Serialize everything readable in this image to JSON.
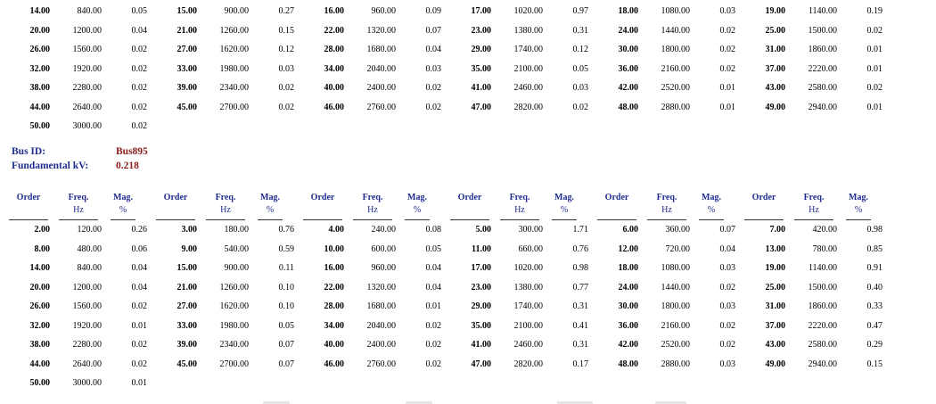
{
  "colors": {
    "label": "#1f2d8f",
    "value": "#8b1a1a"
  },
  "bus_info": {
    "bus_id_label": "Bus ID:",
    "bus_id_value": "Bus895",
    "fund_kv_label": "Fundamental kV:",
    "fund_kv_value": "0.218"
  },
  "headers": [
    {
      "top": "Order",
      "bottom": ""
    },
    {
      "top": "Freq.",
      "bottom": "Hz"
    },
    {
      "top": "Mag.",
      "bottom": "%"
    }
  ],
  "table1": {
    "rows": [
      [
        [
          "14.00",
          "840.00",
          "0.05"
        ],
        [
          "15.00",
          "900.00",
          "0.27"
        ],
        [
          "16.00",
          "960.00",
          "0.09"
        ],
        [
          "17.00",
          "1020.00",
          "0.97"
        ],
        [
          "18.00",
          "1080.00",
          "0.03"
        ],
        [
          "19.00",
          "1140.00",
          "0.19"
        ]
      ],
      [
        [
          "20.00",
          "1200.00",
          "0.04"
        ],
        [
          "21.00",
          "1260.00",
          "0.15"
        ],
        [
          "22.00",
          "1320.00",
          "0.07"
        ],
        [
          "23.00",
          "1380.00",
          "0.31"
        ],
        [
          "24.00",
          "1440.00",
          "0.02"
        ],
        [
          "25.00",
          "1500.00",
          "0.02"
        ]
      ],
      [
        [
          "26.00",
          "1560.00",
          "0.02"
        ],
        [
          "27.00",
          "1620.00",
          "0.12"
        ],
        [
          "28.00",
          "1680.00",
          "0.04"
        ],
        [
          "29.00",
          "1740.00",
          "0.12"
        ],
        [
          "30.00",
          "1800.00",
          "0.02"
        ],
        [
          "31.00",
          "1860.00",
          "0.01"
        ]
      ],
      [
        [
          "32.00",
          "1920.00",
          "0.02"
        ],
        [
          "33.00",
          "1980.00",
          "0.03"
        ],
        [
          "34.00",
          "2040.00",
          "0.03"
        ],
        [
          "35.00",
          "2100.00",
          "0.05"
        ],
        [
          "36.00",
          "2160.00",
          "0.02"
        ],
        [
          "37.00",
          "2220.00",
          "0.01"
        ]
      ],
      [
        [
          "38.00",
          "2280.00",
          "0.02"
        ],
        [
          "39.00",
          "2340.00",
          "0.02"
        ],
        [
          "40.00",
          "2400.00",
          "0.02"
        ],
        [
          "41.00",
          "2460.00",
          "0.03"
        ],
        [
          "42.00",
          "2520.00",
          "0.01"
        ],
        [
          "43.00",
          "2580.00",
          "0.02"
        ]
      ],
      [
        [
          "44.00",
          "2640.00",
          "0.02"
        ],
        [
          "45.00",
          "2700.00",
          "0.02"
        ],
        [
          "46.00",
          "2760.00",
          "0.02"
        ],
        [
          "47.00",
          "2820.00",
          "0.02"
        ],
        [
          "48.00",
          "2880.00",
          "0.01"
        ],
        [
          "49.00",
          "2940.00",
          "0.01"
        ]
      ],
      [
        [
          "50.00",
          "3000.00",
          "0.02"
        ]
      ]
    ]
  },
  "table2": {
    "rows": [
      [
        [
          "2.00",
          "120.00",
          "0.26"
        ],
        [
          "3.00",
          "180.00",
          "0.76"
        ],
        [
          "4.00",
          "240.00",
          "0.08"
        ],
        [
          "5.00",
          "300.00",
          "1.71"
        ],
        [
          "6.00",
          "360.00",
          "0.07"
        ],
        [
          "7.00",
          "420.00",
          "0.98"
        ]
      ],
      [
        [
          "8.00",
          "480.00",
          "0.06"
        ],
        [
          "9.00",
          "540.00",
          "0.59"
        ],
        [
          "10.00",
          "600.00",
          "0.05"
        ],
        [
          "11.00",
          "660.00",
          "0.76"
        ],
        [
          "12.00",
          "720.00",
          "0.04"
        ],
        [
          "13.00",
          "780.00",
          "0.85"
        ]
      ],
      [
        [
          "14.00",
          "840.00",
          "0.04"
        ],
        [
          "15.00",
          "900.00",
          "0.11"
        ],
        [
          "16.00",
          "960.00",
          "0.04"
        ],
        [
          "17.00",
          "1020.00",
          "0.98"
        ],
        [
          "18.00",
          "1080.00",
          "0.03"
        ],
        [
          "19.00",
          "1140.00",
          "0.91"
        ]
      ],
      [
        [
          "20.00",
          "1200.00",
          "0.04"
        ],
        [
          "21.00",
          "1260.00",
          "0.10"
        ],
        [
          "22.00",
          "1320.00",
          "0.04"
        ],
        [
          "23.00",
          "1380.00",
          "0.77"
        ],
        [
          "24.00",
          "1440.00",
          "0.02"
        ],
        [
          "25.00",
          "1500.00",
          "0.40"
        ]
      ],
      [
        [
          "26.00",
          "1560.00",
          "0.02"
        ],
        [
          "27.00",
          "1620.00",
          "0.10"
        ],
        [
          "28.00",
          "1680.00",
          "0.01"
        ],
        [
          "29.00",
          "1740.00",
          "0.31"
        ],
        [
          "30.00",
          "1800.00",
          "0.03"
        ],
        [
          "31.00",
          "1860.00",
          "0.33"
        ]
      ],
      [
        [
          "32.00",
          "1920.00",
          "0.01"
        ],
        [
          "33.00",
          "1980.00",
          "0.05"
        ],
        [
          "34.00",
          "2040.00",
          "0.02"
        ],
        [
          "35.00",
          "2100.00",
          "0.41"
        ],
        [
          "36.00",
          "2160.00",
          "0.02"
        ],
        [
          "37.00",
          "2220.00",
          "0.47"
        ]
      ],
      [
        [
          "38.00",
          "2280.00",
          "0.02"
        ],
        [
          "39.00",
          "2340.00",
          "0.07"
        ],
        [
          "40.00",
          "2400.00",
          "0.02"
        ],
        [
          "41.00",
          "2460.00",
          "0.31"
        ],
        [
          "42.00",
          "2520.00",
          "0.02"
        ],
        [
          "43.00",
          "2580.00",
          "0.29"
        ]
      ],
      [
        [
          "44.00",
          "2640.00",
          "0.02"
        ],
        [
          "45.00",
          "2700.00",
          "0.07"
        ],
        [
          "46.00",
          "2760.00",
          "0.02"
        ],
        [
          "47.00",
          "2820.00",
          "0.17"
        ],
        [
          "48.00",
          "2880.00",
          "0.03"
        ],
        [
          "49.00",
          "2940.00",
          "0.15"
        ]
      ],
      [
        [
          "50.00",
          "3000.00",
          "0.01"
        ]
      ]
    ]
  }
}
